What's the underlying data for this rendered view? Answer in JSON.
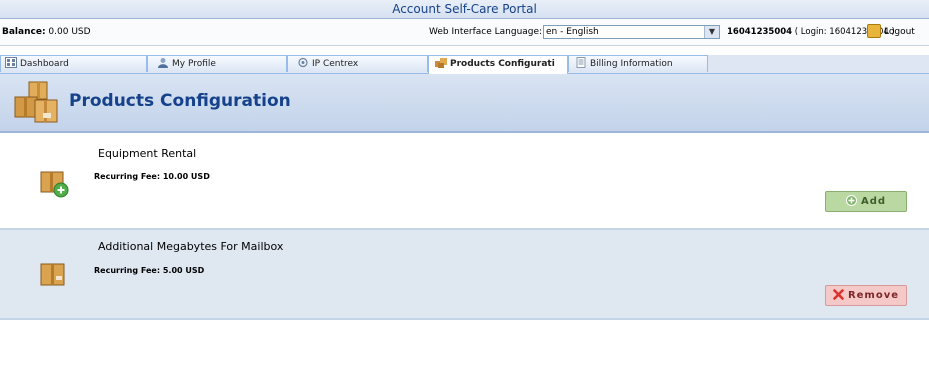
{
  "window": {
    "title": "Account Self-Care Portal"
  },
  "info": {
    "balance_label": "Balance:",
    "balance_value": "0.00 USD",
    "language_label": "Web Interface Language:",
    "language_value": "en - English",
    "account_id": "16041235004",
    "login_text": "( Login: 16041235004 )",
    "logout_label": "Logout"
  },
  "tabs": [
    {
      "label": "Dashboard",
      "icon": "dashboard-icon",
      "active": false
    },
    {
      "label": "My Profile",
      "icon": "user-icon",
      "active": false
    },
    {
      "label": "IP Centrex",
      "icon": "network-icon",
      "active": false
    },
    {
      "label": "Products Configurati",
      "icon": "products-icon",
      "active": true
    },
    {
      "label": "Billing Information",
      "icon": "document-icon",
      "active": false
    }
  ],
  "header": {
    "title": "Products Configuration",
    "icon": "boxes-icon"
  },
  "products": [
    {
      "name": "Equipment Rental",
      "fee": "Recurring Fee: 10.00 USD",
      "action": "Add",
      "icon": "box-add-icon"
    },
    {
      "name": "Additional Megabytes For Mailbox",
      "fee": "Recurring Fee: 5.00 USD",
      "action": "Remove",
      "icon": "box-icon"
    }
  ],
  "colors": {
    "title_blue": "#15428b",
    "add_green": "#b9d8a2",
    "remove_red": "#f6c9c9"
  }
}
